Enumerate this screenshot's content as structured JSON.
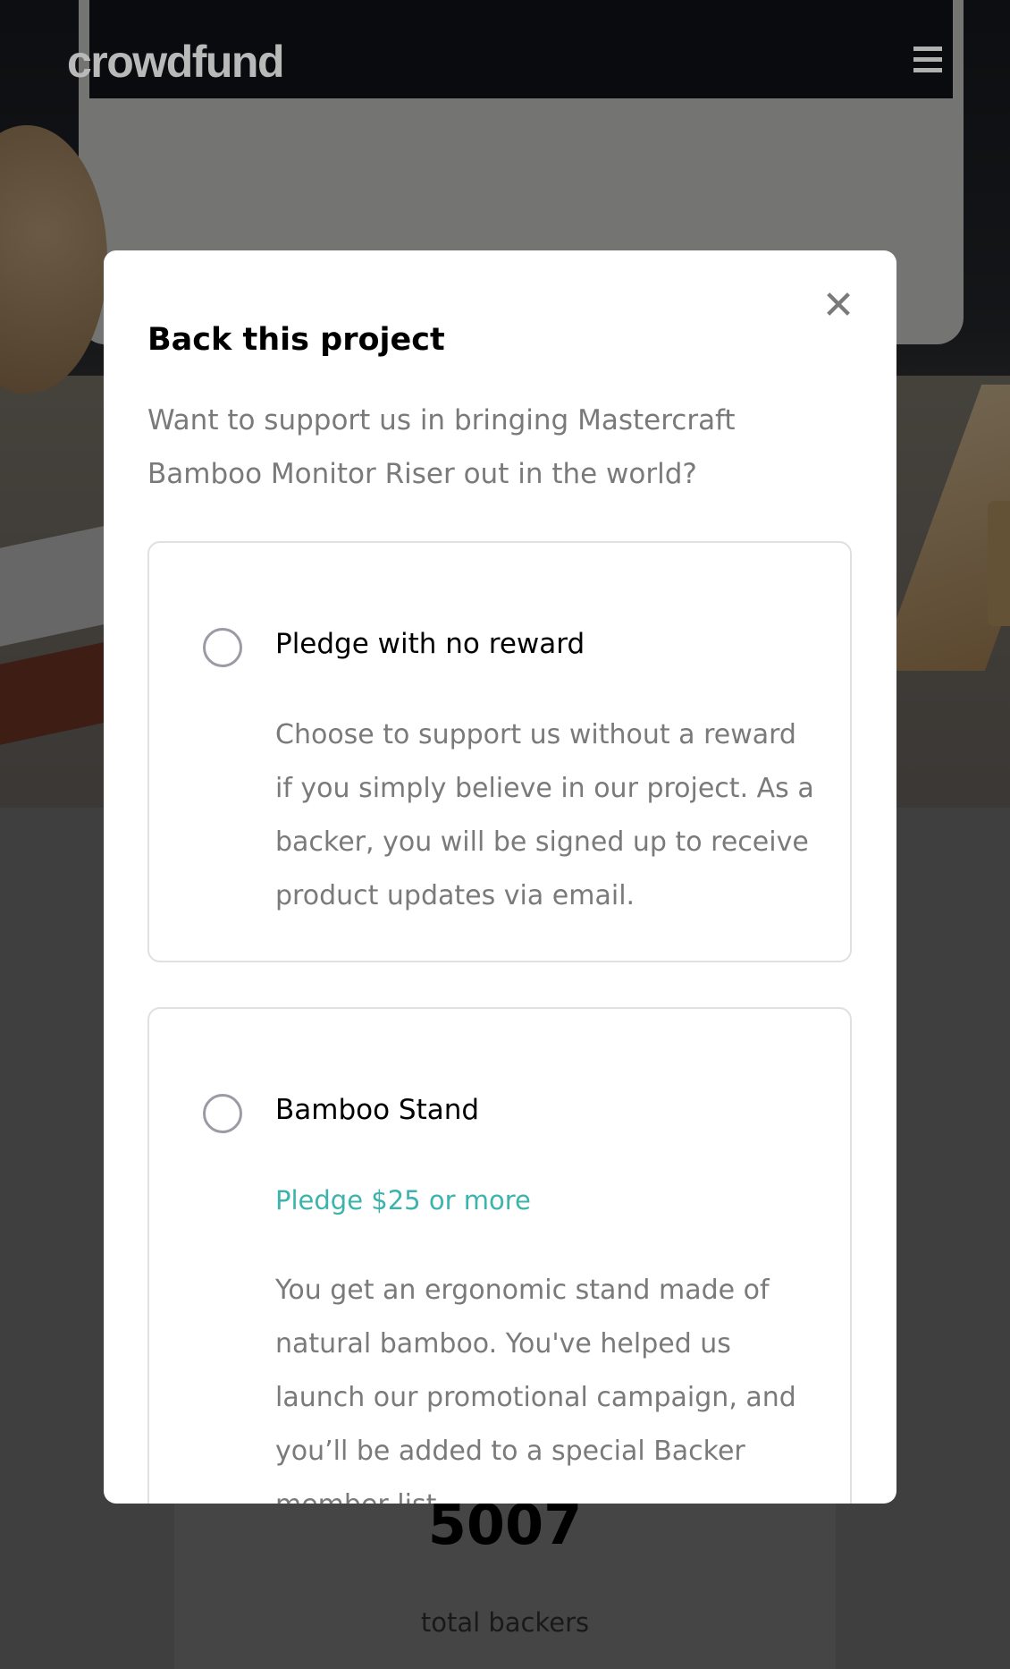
{
  "header": {
    "brand": "crowdfund",
    "menu_icon": "hamburger-icon"
  },
  "modal": {
    "title": "Back this project",
    "description": "Want to support us in bringing Mastercraft Bamboo Monitor Riser out in the world?",
    "close_icon": "close-icon",
    "options": [
      {
        "title": "Pledge with no reward",
        "body": "Choose to support us without a reward if you simply believe in our project. As a backer, you will be signed up to receive product updates via email."
      },
      {
        "title": "Bamboo Stand",
        "pledge": "Pledge $25 or more",
        "body": "You get an ergonomic stand made of natural bamboo. You've helped us launch our promotional campaign, and you’ll be added to a special Backer member list."
      }
    ]
  },
  "stats": {
    "backers_value": "5007",
    "backers_label": "total backers"
  },
  "colors": {
    "accent": "#3cb3ab",
    "overlay": "#000000",
    "modal_bg": "#ffffff"
  }
}
